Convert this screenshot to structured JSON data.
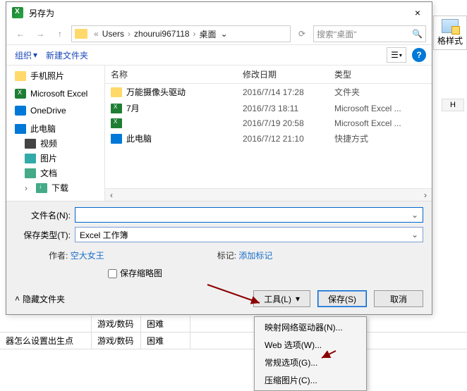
{
  "dialog": {
    "title": "另存为",
    "close": "×",
    "breadcrumb": {
      "sep1": "«",
      "p1": "Users",
      "p2": "zhourui967118",
      "p3": "桌面"
    },
    "search_placeholder": "搜索\"桌面\"",
    "toolbar": {
      "organize": "组织",
      "newfolder": "新建文件夹"
    },
    "sidebar": {
      "items": [
        {
          "label": "手机照片"
        },
        {
          "label": "Microsoft Excel"
        },
        {
          "label": "OneDrive"
        },
        {
          "label": "此电脑"
        },
        {
          "label": "视频"
        },
        {
          "label": "图片"
        },
        {
          "label": "文档"
        },
        {
          "label": "下载"
        }
      ]
    },
    "columns": {
      "name": "名称",
      "date": "修改日期",
      "type": "类型"
    },
    "files": [
      {
        "name": "万能摄像头驱动",
        "date": "2016/7/14 17:28",
        "type": "文件夹"
      },
      {
        "name": "7月",
        "date": "2016/7/3 18:11",
        "type": "Microsoft Excel ..."
      },
      {
        "name": "",
        "date": "2016/7/19 20:58",
        "type": "Microsoft Excel ..."
      },
      {
        "name": "此电脑",
        "date": "2016/7/12 21:10",
        "type": "快捷方式"
      }
    ],
    "form": {
      "filename_label": "文件名(N):",
      "filename_value": "",
      "filetype_label": "保存类型(T):",
      "filetype_value": "Excel 工作簿",
      "author_label": "作者:",
      "author_value": "空大女王",
      "tags_label": "标记:",
      "tags_value": "添加标记",
      "thumb_label": "保存缩略图"
    },
    "buttons": {
      "hide": "隐藏文件夹",
      "tools": "工具(L)",
      "save": "保存(S)",
      "cancel": "取消"
    }
  },
  "menu": {
    "items": [
      "映射网络驱动器(N)...",
      "Web 选项(W)...",
      "常规选项(G)...",
      "压缩图片(C)..."
    ]
  },
  "bg": {
    "row1": {
      "c1": "",
      "c2": "游戏/数码",
      "c3": "困难"
    },
    "row2": {
      "c1": "器怎么设置出生点",
      "c2": "游戏/数码",
      "c3": "困难"
    }
  },
  "right": {
    "fmt_label": "格样式",
    "col_h": "H"
  }
}
